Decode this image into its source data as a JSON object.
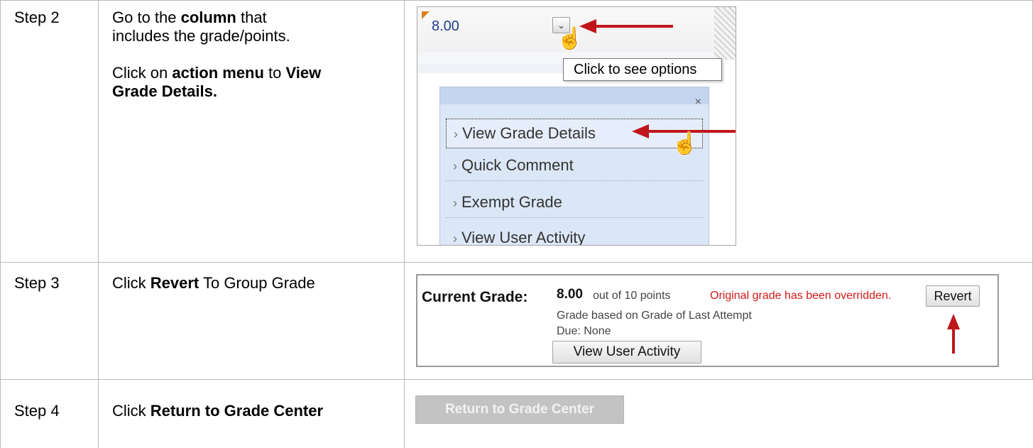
{
  "steps": [
    {
      "label": "Step 2",
      "instruction_lines": [
        [
          {
            "t": "Go to the "
          },
          {
            "t": "column",
            "b": true
          },
          {
            "t": " that"
          }
        ],
        [
          {
            "t": "includes the grade/points."
          }
        ],
        [],
        [
          {
            "t": "Click on "
          },
          {
            "t": "action menu",
            "b": true
          },
          {
            "t": " to "
          },
          {
            "t": "View",
            "b": true
          }
        ],
        [
          {
            "t": "Grade Details.",
            "b": true
          }
        ]
      ]
    },
    {
      "label": "Step 3",
      "instruction_lines": [
        [
          {
            "t": "Click "
          },
          {
            "t": "Revert",
            "b": true
          },
          {
            "t": " To Group Grade"
          }
        ]
      ]
    },
    {
      "label": "Step 4",
      "instruction_lines": [
        [
          {
            "t": "Click "
          },
          {
            "t": "Return to Grade Center",
            "b": true
          }
        ]
      ]
    }
  ],
  "step2_shot": {
    "grade_value": "8.00",
    "action_icon": "chevron-down-icon",
    "tooltip": "Click to see options",
    "menu_close": "×",
    "menu_items": [
      "View Grade Details",
      "Quick Comment",
      "Exempt Grade",
      "View User Activity"
    ],
    "focused_item_index": 0
  },
  "step3_shot": {
    "current_grade_label": "Current Grade:",
    "grade": "8.00",
    "out_of": "out of 10 points",
    "override_notice": "Original grade has been overridden.",
    "revert_label": "Revert",
    "based_on": "Grade based on Grade of Last Attempt",
    "due": "Due: None",
    "view_activity_label": "View User Activity"
  },
  "step4": {
    "return_button_label": "Return to Grade Center"
  },
  "colors": {
    "arrow": "#c0161b",
    "override_text": "#d21a1a",
    "grade_text": "#1e3f8a",
    "menu_bg": "#dbe6f6"
  }
}
